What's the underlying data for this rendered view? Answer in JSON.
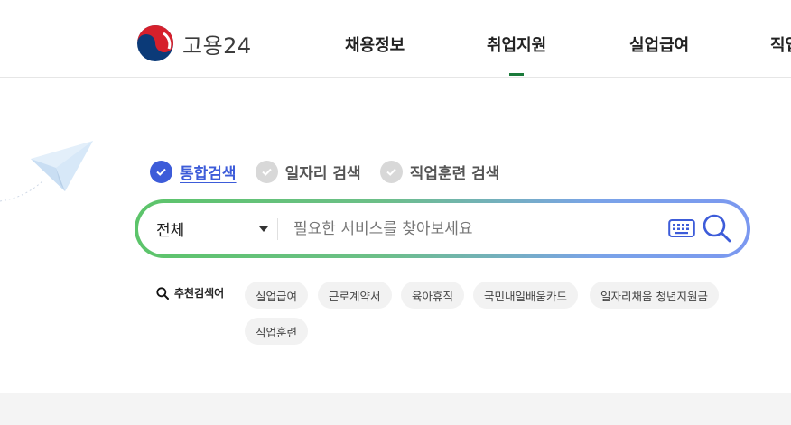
{
  "header": {
    "logo_text": "고용24",
    "nav": [
      {
        "label": "채용정보",
        "active": false
      },
      {
        "label": "취업지원",
        "active": true
      },
      {
        "label": "실업급여",
        "active": false
      },
      {
        "label": "직업",
        "active": false
      }
    ],
    "accent_color": "#1a7a3a"
  },
  "search": {
    "tabs": [
      {
        "label": "통합검색",
        "active": true
      },
      {
        "label": "일자리 검색",
        "active": false
      },
      {
        "label": "직업훈련 검색",
        "active": false
      }
    ],
    "scope_selected": "전체",
    "placeholder": "필요한 서비스를 찾아보세요",
    "keyboard_icon": "keyboard-icon",
    "search_icon": "search-icon",
    "active_color": "#3d5cd9"
  },
  "recommended": {
    "label": "추천검색어",
    "keywords": [
      "실업급여",
      "근로계약서",
      "육아휴직",
      "국민내일배움카드",
      "일자리채움 청년지원금",
      "직업훈련"
    ]
  }
}
